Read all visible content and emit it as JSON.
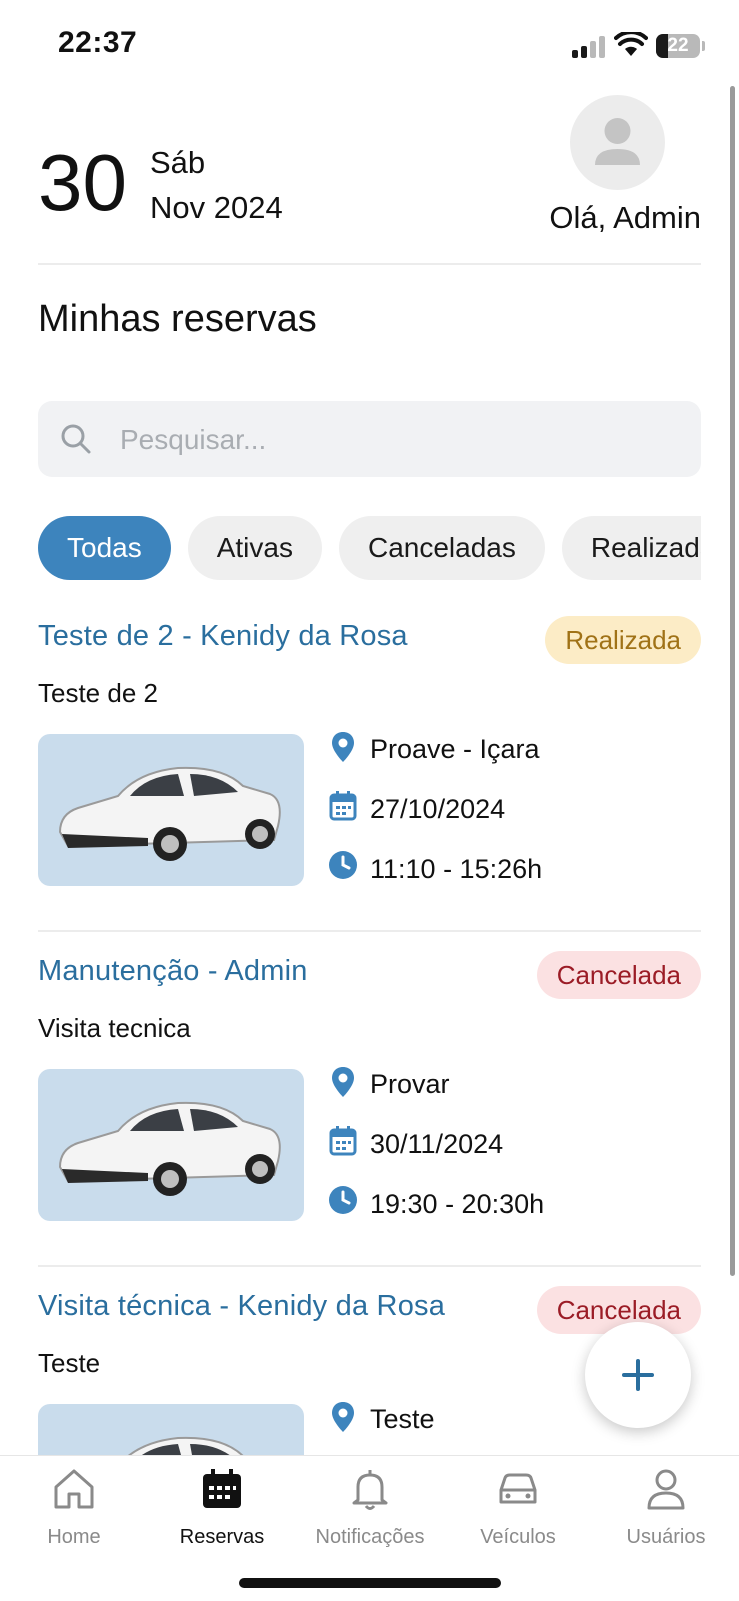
{
  "status_bar": {
    "time": "22:37",
    "battery": "22"
  },
  "header": {
    "day": "30",
    "weekday": "Sáb",
    "month_year": "Nov 2024",
    "greeting": "Olá, Admin"
  },
  "page": {
    "title": "Minhas reservas"
  },
  "search": {
    "placeholder": "Pesquisar...",
    "value": ""
  },
  "filters": [
    {
      "label": "Todas",
      "active": true
    },
    {
      "label": "Ativas",
      "active": false
    },
    {
      "label": "Canceladas",
      "active": false
    },
    {
      "label": "Realizadas",
      "active": false
    }
  ],
  "reservations": [
    {
      "title": "Teste de 2 - Kenidy da Rosa",
      "status": "Realizada",
      "description": "Teste de 2",
      "location": "Proave - Içara",
      "date": "27/10/2024",
      "time": "11:10 - 15:26h"
    },
    {
      "title": "Manutenção - Admin",
      "status": "Cancelada",
      "description": "Visita tecnica",
      "location": "Provar",
      "date": "30/11/2024",
      "time": "19:30 - 20:30h"
    },
    {
      "title": "Visita técnica - Kenidy da Rosa",
      "status": "Cancelada",
      "description": "Teste",
      "location": "Teste",
      "date": "",
      "time": ""
    }
  ],
  "fab": {
    "icon": "plus-icon"
  },
  "bottom_nav": [
    {
      "label": "Home",
      "icon": "home-icon",
      "active": false
    },
    {
      "label": "Reservas",
      "icon": "calendar-icon",
      "active": true
    },
    {
      "label": "Notificações",
      "icon": "bell-icon",
      "active": false
    },
    {
      "label": "Veículos",
      "icon": "car-icon",
      "active": false
    },
    {
      "label": "Usuários",
      "icon": "user-icon",
      "active": false
    }
  ],
  "colors": {
    "accent": "#3d84bd",
    "title_blue": "#2a6e9e",
    "badge_done_bg": "#fcecc6",
    "badge_done_text": "#a07217",
    "badge_cancel_bg": "#fbe1e2",
    "badge_cancel_text": "#9b1c26"
  }
}
